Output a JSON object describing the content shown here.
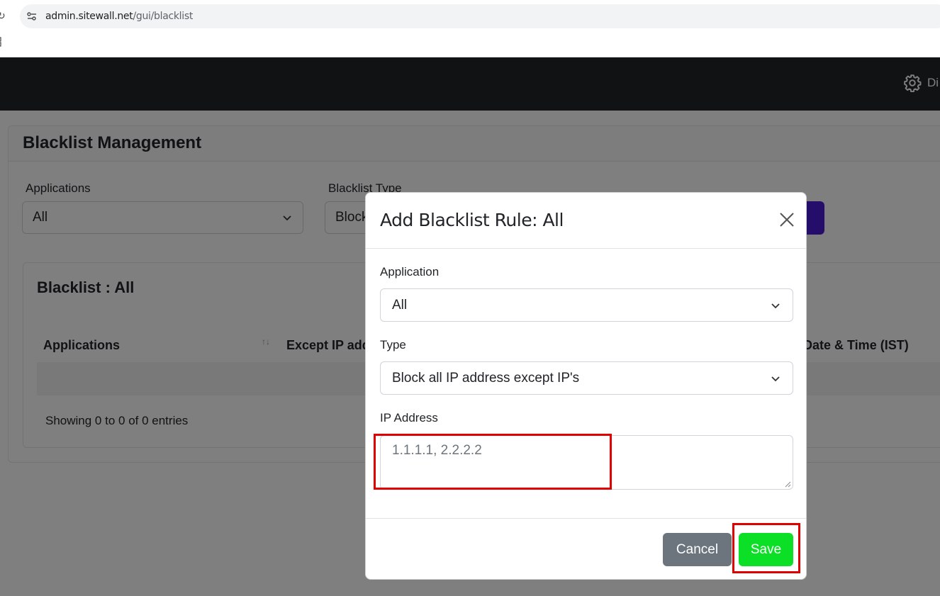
{
  "browser": {
    "url_host": "admin.sitewall.net",
    "url_path": "/gui/blacklist"
  },
  "header": {
    "settings_label": "Di"
  },
  "page": {
    "title": "Blacklist Management",
    "filters": {
      "applications_label": "Applications",
      "applications_value": "All",
      "blacklist_type_label": "Blacklist Type",
      "blacklist_type_value": "Block"
    },
    "table": {
      "title": "Blacklist : All",
      "columns": [
        "Applications",
        "Except IP add",
        "Date & Time (IST)"
      ],
      "sort_glyph": "↑↓",
      "entries_text": "Showing 0 to 0 of 0 entries"
    }
  },
  "modal": {
    "title": "Add Blacklist Rule: All",
    "application_label": "Application",
    "application_value": "All",
    "type_label": "Type",
    "type_value": "Block all IP address except IP's",
    "ip_label": "IP Address",
    "ip_value": "1.1.1.1, 2.2.2.2",
    "cancel_label": "Cancel",
    "save_label": "Save"
  },
  "colors": {
    "header_bg": "#212529",
    "save_bg": "#0be026",
    "cancel_bg": "#6c757d",
    "highlight": "#e00000",
    "purple_button": "#4a1bd8"
  }
}
